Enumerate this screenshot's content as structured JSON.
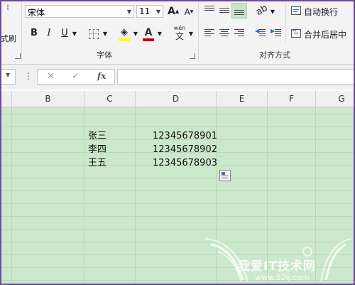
{
  "ribbon": {
    "font_name": "宋体",
    "font_size": "11",
    "left_cut_label": "式刷",
    "bold": "B",
    "italic": "I",
    "underline": "U",
    "grow_font": "A",
    "shrink_font": "A",
    "phonetic_label": "wén",
    "phonetic_char": "文",
    "font_group_label": "字体",
    "align_group_label": "对齐方式",
    "wrap_text_label": "自动换行",
    "merge_center_label": "合并后居中",
    "font_color": "#c00000",
    "fill_color": "#ffff00"
  },
  "formula_bar": {
    "cancel": "✕",
    "confirm": "✓",
    "fx": "fx",
    "value": ""
  },
  "columns": [
    "B",
    "C",
    "D",
    "E",
    "F",
    "G"
  ],
  "rows": [
    {
      "name": "张三",
      "phone": "12345678901"
    },
    {
      "name": "李四",
      "phone": "12345678902"
    },
    {
      "name": "王五",
      "phone": "12345678903"
    }
  ],
  "watermark": {
    "title": "我爱IT技术网",
    "url": "www.52ij.com"
  }
}
